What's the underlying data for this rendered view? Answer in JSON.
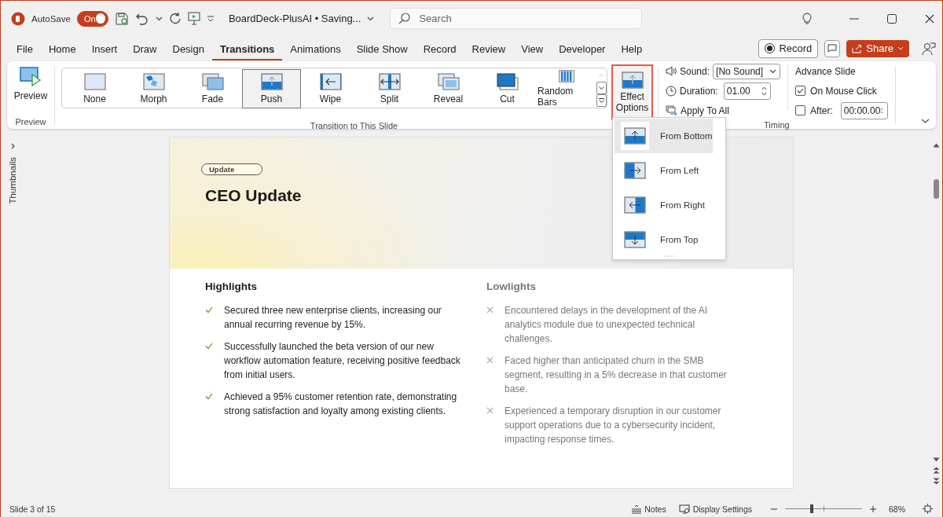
{
  "titlebar": {
    "autosave_label": "AutoSave",
    "autosave": {
      "label": "On",
      "on": true
    },
    "document_title": "BoardDeck-PlusAI • Saving...",
    "search": {
      "placeholder": "Search"
    }
  },
  "menu_tabs": [
    {
      "label": "File",
      "selected": false
    },
    {
      "label": "Home",
      "selected": false
    },
    {
      "label": "Insert",
      "selected": false
    },
    {
      "label": "Draw",
      "selected": false
    },
    {
      "label": "Design",
      "selected": false
    },
    {
      "label": "Transitions",
      "selected": true
    },
    {
      "label": "Animations",
      "selected": false
    },
    {
      "label": "Slide Show",
      "selected": false
    },
    {
      "label": "Record",
      "selected": false
    },
    {
      "label": "Review",
      "selected": false
    },
    {
      "label": "View",
      "selected": false
    },
    {
      "label": "Developer",
      "selected": false
    },
    {
      "label": "Help",
      "selected": false
    }
  ],
  "actions": {
    "record": "Record",
    "share": "Share"
  },
  "ribbon": {
    "preview": {
      "label": "Preview",
      "group": "Preview"
    },
    "transitions": {
      "group": "Transition to This Slide",
      "items": [
        {
          "label": "None",
          "kind": "none",
          "selected": false
        },
        {
          "label": "Morph",
          "kind": "morph",
          "selected": false
        },
        {
          "label": "Fade",
          "kind": "fade",
          "selected": false
        },
        {
          "label": "Push",
          "kind": "push",
          "selected": true
        },
        {
          "label": "Wipe",
          "kind": "wipe",
          "selected": false
        },
        {
          "label": "Split",
          "kind": "split",
          "selected": false
        },
        {
          "label": "Reveal",
          "kind": "reveal",
          "selected": false
        },
        {
          "label": "Cut",
          "kind": "cut",
          "selected": false
        },
        {
          "label": "Random Bars",
          "kind": "bars",
          "selected": false
        }
      ]
    },
    "effect_options": {
      "label": "Effect Options",
      "highlighted": true
    },
    "timing": {
      "group": "Timing",
      "sound": {
        "label": "Sound:",
        "value": "[No Sound]"
      },
      "duration": {
        "label": "Duration:",
        "value": "01.00"
      },
      "apply_to_all": "Apply To All",
      "advance_slide": "Advance Slide",
      "on_mouse_click": {
        "label": "On Mouse Click",
        "checked": true
      },
      "after": {
        "label": "After:",
        "checked": false,
        "value": "00:00.00"
      }
    }
  },
  "effect_menu": {
    "items": [
      {
        "label": "From Bottom",
        "kind": "bottom",
        "selected": true
      },
      {
        "label": "From Left",
        "kind": "left",
        "selected": false
      },
      {
        "label": "From Right",
        "kind": "right",
        "selected": false
      },
      {
        "label": "From Top",
        "kind": "top",
        "selected": false
      }
    ]
  },
  "side_panel": {
    "label": "Thumbnails"
  },
  "slide": {
    "badge": "Update",
    "title": "CEO Update",
    "columns": [
      {
        "heading": "Highlights",
        "kind": "check",
        "items": [
          "Secured three new enterprise clients, increasing our annual recurring revenue by 15%.",
          "Successfully launched the beta version of our new workflow automation feature, receiving positive feedback from initial users.",
          "Achieved a 95% customer retention rate, demonstrating strong satisfaction and loyalty among existing clients."
        ]
      },
      {
        "heading": "Lowlights",
        "kind": "cross",
        "items": [
          "Encountered delays in the development of the AI analytics module due to unexpected technical challenges.",
          "Faced higher than anticipated churn in the SMB segment, resulting in a 5% decrease in that customer base.",
          "Experienced a temporary disruption in our customer support operations due to a cybersecurity incident, impacting response times."
        ]
      }
    ]
  },
  "status_bar": {
    "slide_info": "Slide 3 of 15",
    "notes": "Notes",
    "display_settings": "Display Settings",
    "zoom": {
      "level": 0.35,
      "reading": "68%"
    }
  }
}
